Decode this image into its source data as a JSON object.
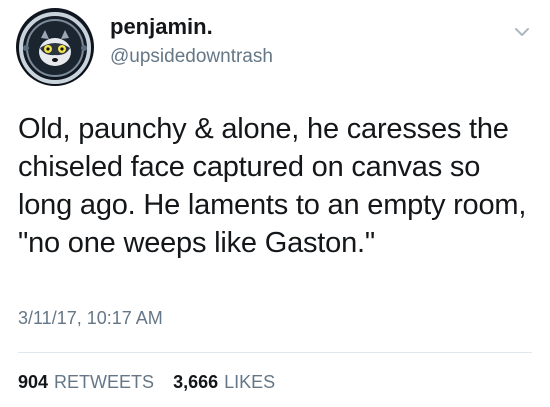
{
  "author": {
    "display_name": "penjamin.",
    "handle": "@upsidedowntrash",
    "avatar": "astronaut-raccoon-avatar"
  },
  "menu": {
    "icon": "chevron-down-icon"
  },
  "tweet": {
    "text": "Old, paunchy & alone, he caresses the chiseled face captured on canvas so long ago. He laments to an empty room, \"no one weeps like Gaston.\"",
    "timestamp": "3/11/17, 10:17 AM"
  },
  "stats": {
    "retweets_count": "904",
    "retweets_label": "RETWEETS",
    "likes_count": "3,666",
    "likes_label": "LIKES"
  }
}
